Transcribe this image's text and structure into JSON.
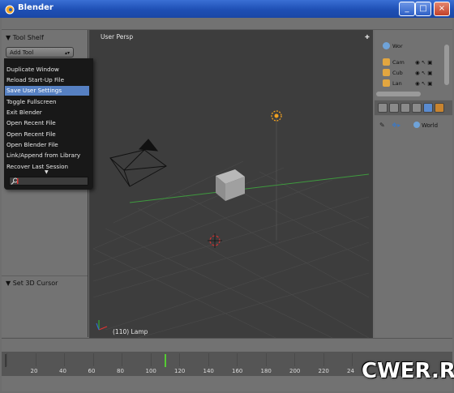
{
  "window": {
    "title": "Blender"
  },
  "tool_shelf": {
    "title": "Tool Shelf",
    "add_tool_label": "Add Tool",
    "set_cursor_label": "Set 3D Cursor"
  },
  "menu": {
    "items": [
      {
        "label": "Duplicate Window"
      },
      {
        "label": "Reload Start-Up File"
      },
      {
        "label": "Save User Settings"
      },
      {
        "label": "Toggle Fullscreen"
      },
      {
        "label": "Exit Blender"
      },
      {
        "label": "Open Recent File"
      },
      {
        "label": "Open Recent File"
      },
      {
        "label": "Open Blender File"
      },
      {
        "label": "Link/Append from Library"
      },
      {
        "label": "Recover Last Session"
      }
    ],
    "search_value": ""
  },
  "viewport": {
    "view_label": "User Persp",
    "object_label": "(110) Lamp"
  },
  "outliner": {
    "rows": [
      {
        "label": "Wor"
      },
      {
        "label": "Cam"
      },
      {
        "label": "Cub"
      },
      {
        "label": "Lan"
      }
    ]
  },
  "properties": {
    "world_label": "World"
  },
  "timeline": {
    "ticks": [
      "0",
      "20",
      "40",
      "60",
      "80",
      "100",
      "120",
      "140",
      "160",
      "180",
      "200",
      "220",
      "24"
    ],
    "current_frame": 110
  },
  "watermark": "CWER.RU",
  "colors": {
    "highlight": "#5680c2",
    "playhead": "#55cc33",
    "titlebar": "#1e4fb4"
  }
}
